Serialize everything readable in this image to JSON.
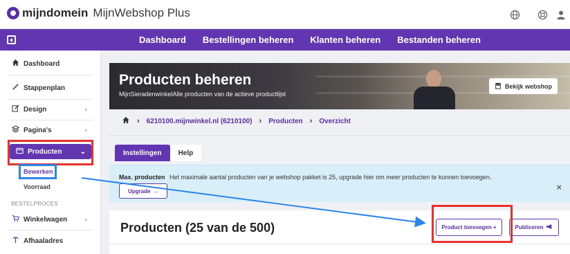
{
  "app": {
    "brand": "mijndomein",
    "product": "MijnWebshop Plus"
  },
  "top_icons": [
    "globe-icon",
    "lifebuoy-icon",
    "user-icon"
  ],
  "nav": {
    "items": [
      "Dashboard",
      "Bestellingen beheren",
      "Klanten beheren",
      "Bestanden beheren"
    ]
  },
  "sidebar": {
    "items": [
      {
        "label": "Dashboard",
        "icon": "home-icon"
      },
      {
        "label": "Stappenplan",
        "icon": "wand-icon"
      },
      {
        "label": "Design",
        "icon": "edit-icon"
      },
      {
        "label": "Pagina's",
        "icon": "layers-icon"
      },
      {
        "label": "Producten",
        "icon": "wallet-icon"
      }
    ],
    "sub_items": [
      "Bewerken",
      "Voorraad"
    ],
    "section": "BESTELPROCES",
    "section_items": [
      {
        "label": "Winkelwagen",
        "icon": "cart-icon"
      },
      {
        "label": "Afhaaladres",
        "icon": "pin-icon"
      }
    ]
  },
  "hero": {
    "title": "Producten beheren",
    "subtitle": "MijnSieradenwinkelAlle producten van de actieve productlijst",
    "button": "Bekijk webshop"
  },
  "breadcrumb": [
    "6210100.mijnwinkel.nl (6210100)",
    "Producten",
    "Overzicht"
  ],
  "tabs": [
    "Instellingen",
    "Help"
  ],
  "alert": {
    "title": "Max. producten",
    "text": "Het maximale aantal producten van je webshop pakket is 25, upgrade hier om meer producten te kunnen toevoegen.",
    "button": "Upgrade"
  },
  "main": {
    "title": "Producten (25 van de 500)",
    "add_button": "Product toevoegen",
    "publish_button": "Publiceren"
  },
  "colors": {
    "brand": "#6236b0",
    "highlight_red": "#e6322a",
    "highlight_blue": "#2b86e8",
    "alert_bg": "#d8eef8"
  }
}
